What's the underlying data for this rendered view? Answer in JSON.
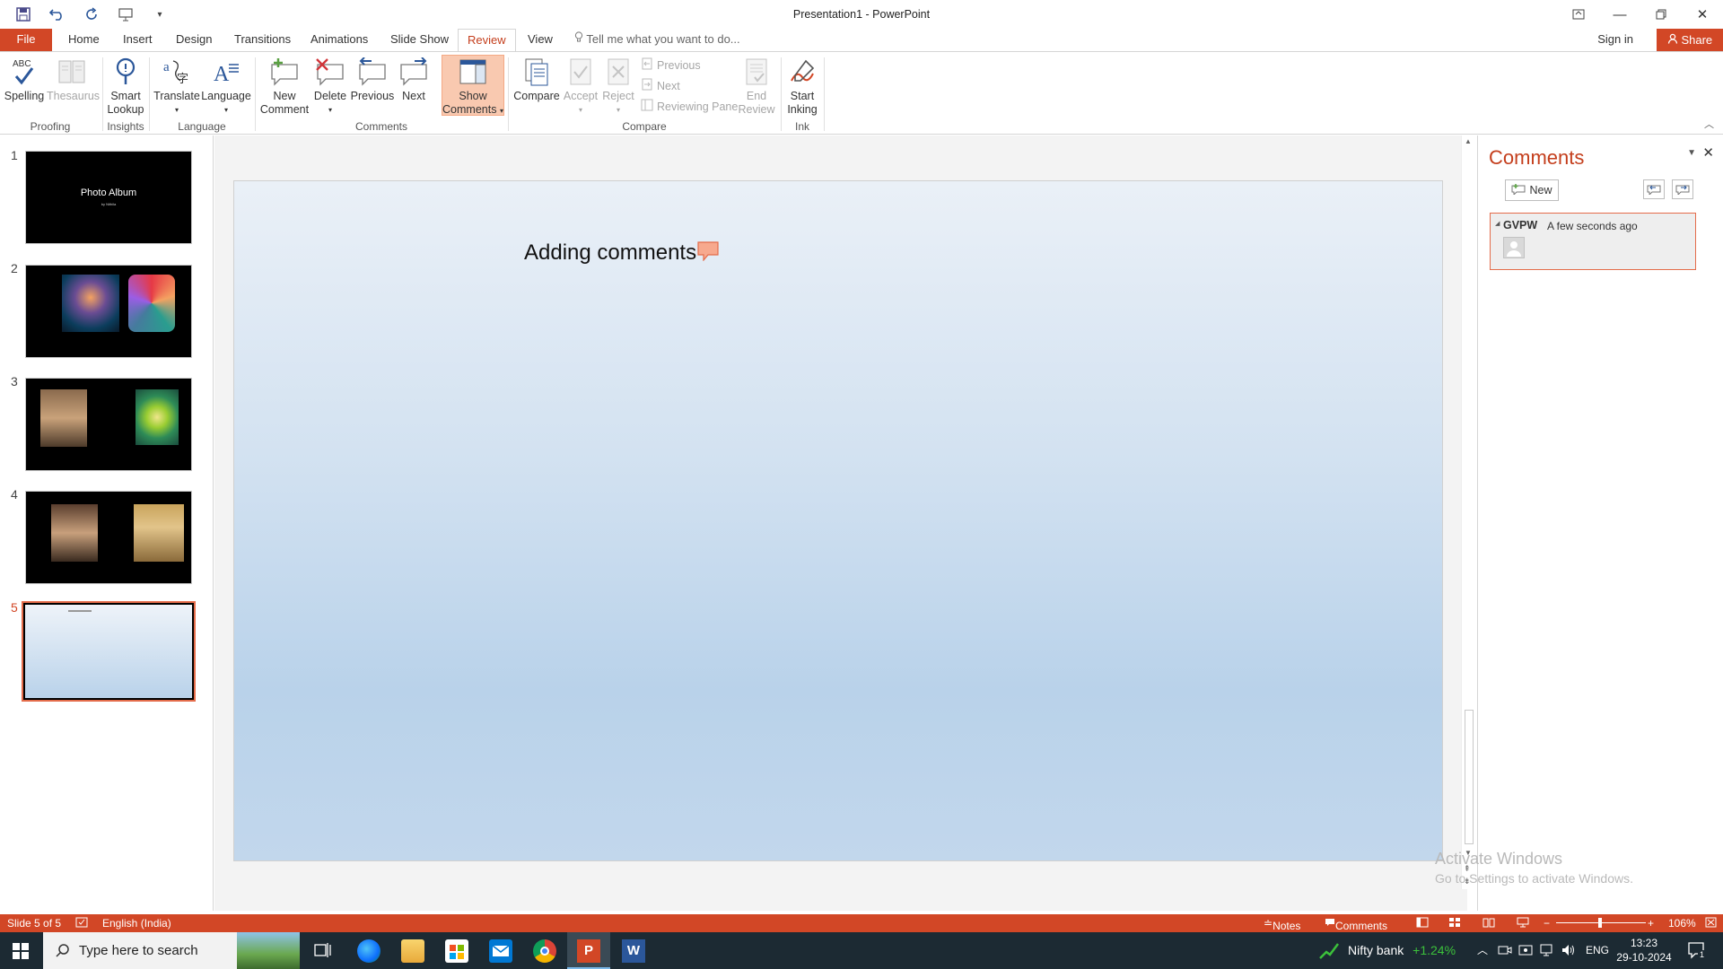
{
  "window": {
    "title": "Presentation1 - PowerPoint"
  },
  "tabs": {
    "file": "File",
    "items": [
      "Home",
      "Insert",
      "Design",
      "Transitions",
      "Animations",
      "Slide Show",
      "Review",
      "View"
    ],
    "active": "Review",
    "tell_me": "Tell me what you want to do...",
    "sign_in": "Sign in",
    "share": "Share"
  },
  "ribbon": {
    "spelling": "Spelling",
    "thesaurus": "Thesaurus",
    "smart_lookup_1": "Smart",
    "smart_lookup_2": "Lookup",
    "translate": "Translate",
    "language": "Language",
    "new_comment_1": "New",
    "new_comment_2": "Comment",
    "delete": "Delete",
    "previous": "Previous",
    "next": "Next",
    "show_comments_1": "Show",
    "show_comments_2": "Comments",
    "compare": "Compare",
    "accept": "Accept",
    "reject": "Reject",
    "cmp_previous": "Previous",
    "cmp_next": "Next",
    "reviewing_pane": "Reviewing Pane",
    "end_review_1": "End",
    "end_review_2": "Review",
    "start_inking_1": "Start",
    "start_inking_2": "Inking",
    "groups": {
      "proofing": "Proofing",
      "insights": "Insights",
      "language": "Language",
      "comments": "Comments",
      "compare": "Compare",
      "ink": "Ink"
    },
    "spell_abc": "ABC"
  },
  "thumbnails": [
    {
      "num": "1",
      "title": "Photo Album",
      "subtitle": "by Nithila"
    },
    {
      "num": "2"
    },
    {
      "num": "3"
    },
    {
      "num": "4"
    },
    {
      "num": "5"
    }
  ],
  "slide": {
    "text": "Adding comments"
  },
  "comments_pane": {
    "title": "Comments",
    "new_label": "New",
    "comment": {
      "author": "GVPW",
      "time": "A few seconds ago"
    }
  },
  "watermark": {
    "line1": "Activate Windows",
    "line2": "Go to Settings to activate Windows."
  },
  "statusbar": {
    "slide": "Slide 5 of 5",
    "language": "English (India)",
    "notes": "Notes",
    "comments": "Comments",
    "zoom": "106%"
  },
  "taskbar": {
    "search_placeholder": "Type here to search",
    "stock_name": "Nifty bank",
    "stock_change": "+1.24%",
    "lang": "ENG",
    "time": "13:23",
    "date": "29-10-2024",
    "notif_count": "1"
  },
  "colors": {
    "accent": "#d24726",
    "active_tab": "#c43e1c",
    "comment_border": "#e46c4a"
  }
}
